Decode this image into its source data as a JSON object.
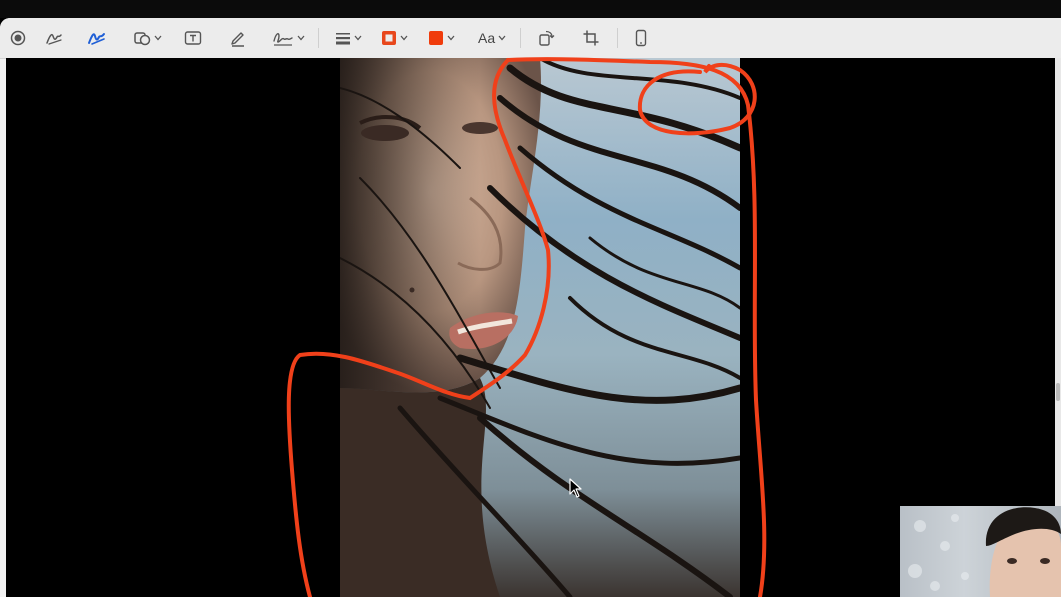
{
  "toolbar": {
    "tools": [
      {
        "name": "record-icon"
      },
      {
        "name": "sketch-icon"
      },
      {
        "name": "draw-icon",
        "selected": true
      },
      {
        "name": "shapes-icon"
      },
      {
        "name": "text-box-icon"
      },
      {
        "name": "highlight-icon"
      },
      {
        "name": "signature-icon"
      },
      {
        "name": "line-style-icon"
      },
      {
        "name": "border-color-icon",
        "color": "#e8471c"
      },
      {
        "name": "fill-color-icon",
        "color": "#f03c0c"
      },
      {
        "name": "rotate-icon"
      },
      {
        "name": "crop-icon"
      },
      {
        "name": "device-icon"
      }
    ],
    "text_style_label": "Aa"
  },
  "colors": {
    "annotation": "#f0401a",
    "selected_tool": "#1f5fd6"
  }
}
